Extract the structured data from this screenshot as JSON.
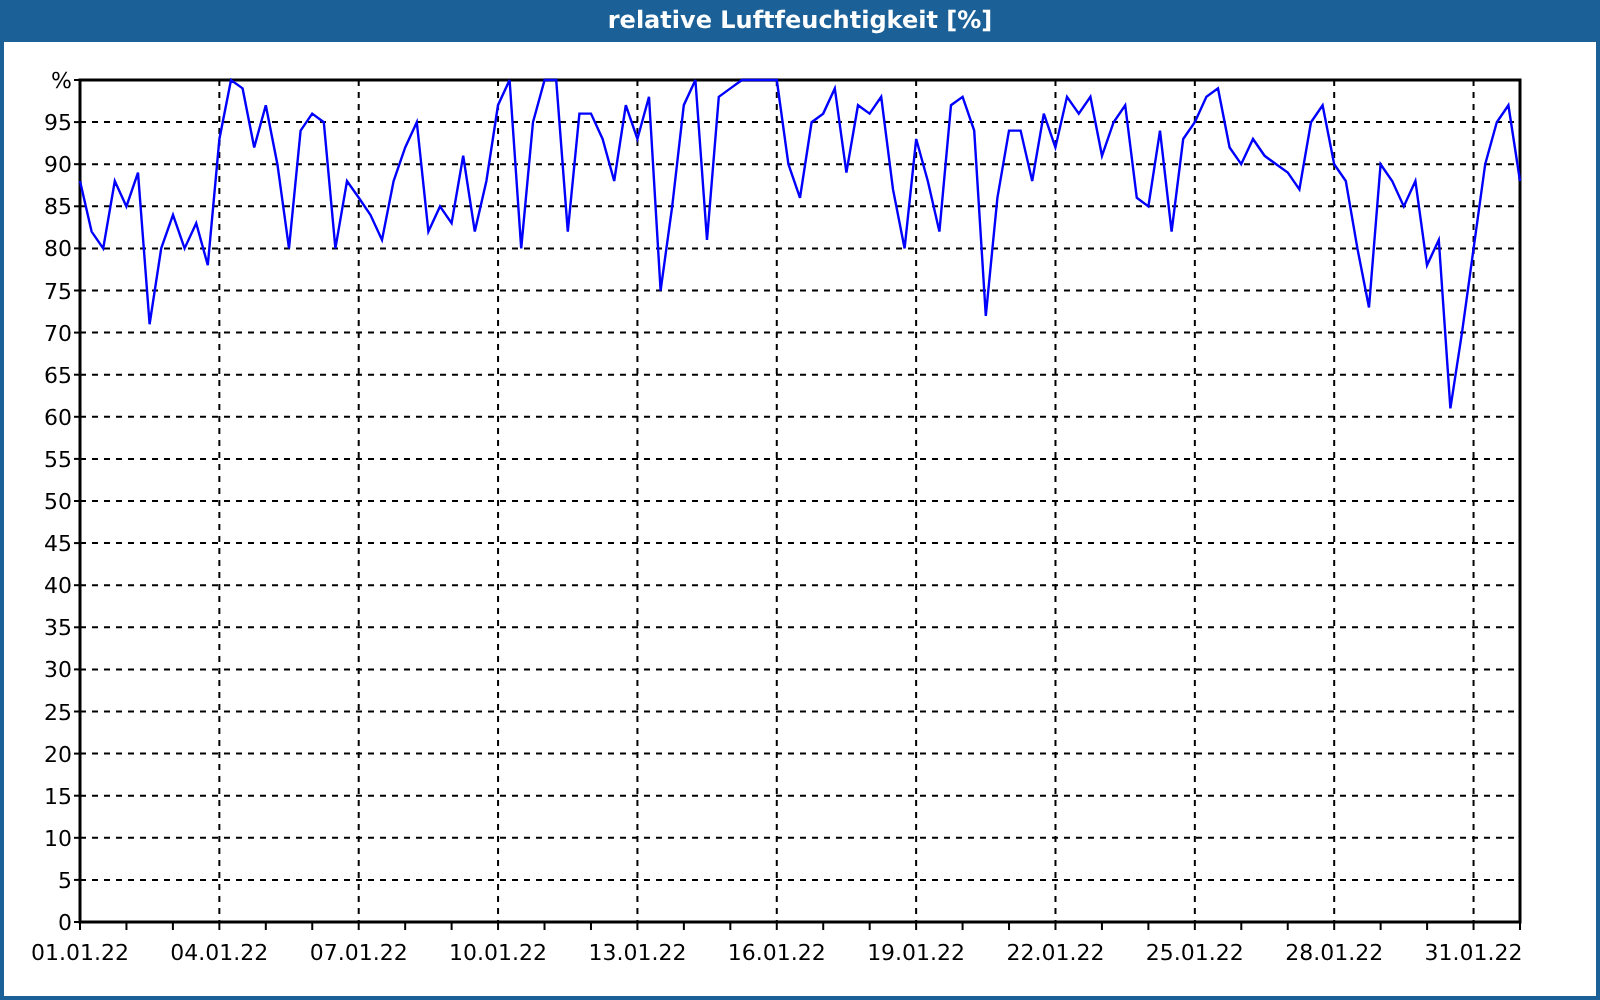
{
  "window": {
    "title": "relative Luftfeuchtigkeit [%]"
  },
  "chart": {
    "chart_data": {
      "type": "line",
      "ylim": [
        0,
        100
      ],
      "grid": true,
      "yticks": [
        0,
        5,
        10,
        15,
        20,
        25,
        30,
        35,
        40,
        45,
        50,
        55,
        60,
        65,
        70,
        75,
        80,
        85,
        90,
        95,
        {
          "value": 100,
          "label": "%"
        }
      ],
      "categories": [
        "01.01.22",
        null,
        null,
        null,
        null,
        null,
        null,
        null,
        null,
        null,
        null,
        null,
        "04.01.22",
        null,
        null,
        null,
        null,
        null,
        null,
        null,
        null,
        null,
        null,
        null,
        "07.01.22",
        null,
        null,
        null,
        null,
        null,
        null,
        null,
        null,
        null,
        null,
        null,
        "10.01.22",
        null,
        null,
        null,
        null,
        null,
        null,
        null,
        null,
        null,
        null,
        null,
        "13.01.22",
        null,
        null,
        null,
        null,
        null,
        null,
        null,
        null,
        null,
        null,
        null,
        "16.01.22",
        null,
        null,
        null,
        null,
        null,
        null,
        null,
        null,
        null,
        null,
        null,
        "19.01.22",
        null,
        null,
        null,
        null,
        null,
        null,
        null,
        null,
        null,
        null,
        null,
        "22.01.22",
        null,
        null,
        null,
        null,
        null,
        null,
        null,
        null,
        null,
        null,
        null,
        "25.01.22",
        null,
        null,
        null,
        null,
        null,
        null,
        null,
        null,
        null,
        null,
        null,
        "28.01.22",
        null,
        null,
        null,
        null,
        null,
        null,
        null,
        null,
        null,
        null,
        null,
        "31.01.22",
        null,
        null,
        null,
        null
      ],
      "series": [
        {
          "color": "#0000ff",
          "values": [
            88,
            82,
            80,
            88,
            85,
            89,
            71,
            80,
            84,
            80,
            83,
            78,
            93,
            100,
            99,
            92,
            97,
            90,
            80,
            94,
            96,
            95,
            80,
            88,
            86,
            84,
            81,
            88,
            92,
            95,
            82,
            85,
            83,
            91,
            82,
            88,
            97,
            100,
            80,
            95,
            100,
            100,
            82,
            96,
            96,
            93,
            88,
            97,
            93,
            98,
            75,
            85,
            97,
            100,
            81,
            98,
            99,
            100,
            100,
            100,
            100,
            90,
            86,
            95,
            96,
            99,
            89,
            97,
            96,
            98,
            87,
            80,
            93,
            88,
            82,
            97,
            98,
            94,
            72,
            86,
            94,
            94,
            88,
            96,
            92,
            98,
            96,
            98,
            91,
            95,
            97,
            86,
            85,
            94,
            82,
            93,
            95,
            98,
            99,
            92,
            90,
            93,
            91,
            90,
            89,
            87,
            95,
            97,
            90,
            88,
            80,
            73,
            90,
            88,
            85,
            88,
            78,
            81,
            61,
            70,
            80,
            90,
            95,
            97,
            88
          ]
        }
      ]
    }
  }
}
